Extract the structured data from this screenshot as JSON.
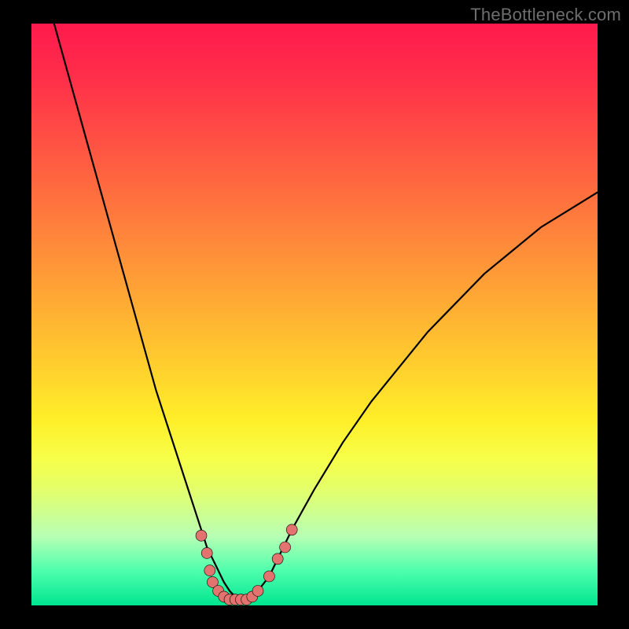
{
  "watermark": "TheBottleneck.com",
  "colors": {
    "frame": "#000000",
    "curve": "#000000",
    "points": "#e3736f"
  },
  "chart_data": {
    "type": "line",
    "title": "",
    "xlabel": "",
    "ylabel": "",
    "xlim": [
      0,
      100
    ],
    "ylim": [
      0,
      100
    ],
    "grid": false,
    "legend": false,
    "series": [
      {
        "name": "bottleneck-curve",
        "x": [
          4,
          6,
          8,
          10,
          12,
          14,
          16,
          18,
          20,
          22,
          24,
          26,
          28,
          30,
          31,
          32,
          33,
          34,
          35,
          36,
          37,
          38,
          39,
          40,
          42,
          44,
          46,
          50,
          55,
          60,
          65,
          70,
          75,
          80,
          85,
          90,
          95,
          100
        ],
        "y": [
          100,
          93,
          86,
          79,
          72,
          65,
          58,
          51,
          44,
          37,
          31,
          25,
          19,
          13,
          10,
          8,
          6,
          4,
          2.5,
          1.5,
          1,
          1,
          1.5,
          2.5,
          5,
          9,
          13,
          20,
          28,
          35,
          41,
          47,
          52,
          57,
          61,
          65,
          68,
          71
        ]
      }
    ],
    "points": [
      {
        "x": 30,
        "y": 12
      },
      {
        "x": 31,
        "y": 9
      },
      {
        "x": 31.5,
        "y": 6
      },
      {
        "x": 32,
        "y": 4
      },
      {
        "x": 33,
        "y": 2.5
      },
      {
        "x": 34,
        "y": 1.5
      },
      {
        "x": 35,
        "y": 1
      },
      {
        "x": 36,
        "y": 1
      },
      {
        "x": 37,
        "y": 1
      },
      {
        "x": 38,
        "y": 1
      },
      {
        "x": 39,
        "y": 1.5
      },
      {
        "x": 40,
        "y": 2.5
      },
      {
        "x": 42,
        "y": 5
      },
      {
        "x": 43.5,
        "y": 8
      },
      {
        "x": 44.8,
        "y": 10
      },
      {
        "x": 46,
        "y": 13
      }
    ],
    "point_radius": 7
  }
}
